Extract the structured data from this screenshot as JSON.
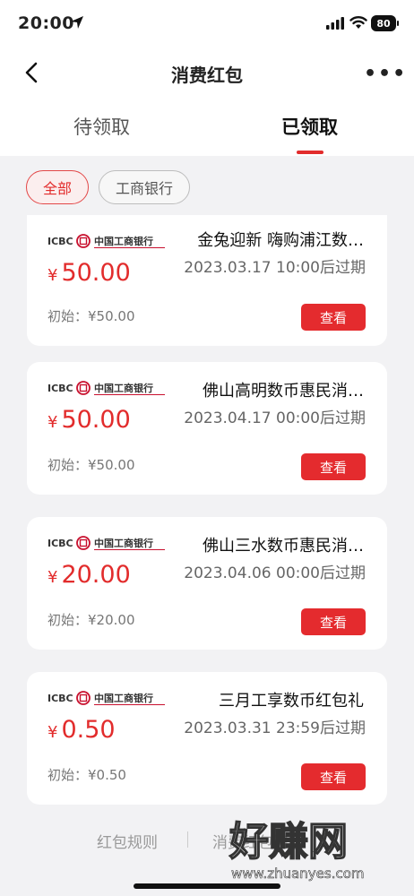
{
  "status": {
    "time": "20:00",
    "battery": "80"
  },
  "nav": {
    "title": "消费红包"
  },
  "tabs": [
    {
      "label": "待领取",
      "active": false
    },
    {
      "label": "已领取",
      "active": true
    }
  ],
  "filters": [
    {
      "label": "全部",
      "selected": true
    },
    {
      "label": "工商银行",
      "selected": false
    }
  ],
  "cards": [
    {
      "bank": "ICBC 中国工商银行",
      "amount": "50.00",
      "currency": "¥",
      "initial": "初始：¥50.00",
      "title": "金兔迎新 嗨购浦江数…",
      "expiry": "2023.03.17 10:00后过期",
      "button": "查看"
    },
    {
      "bank": "ICBC 中国工商银行",
      "amount": "50.00",
      "currency": "¥",
      "initial": "初始：¥50.00",
      "title": "佛山高明数币惠民消…",
      "expiry": "2023.04.17 00:00后过期",
      "button": "查看"
    },
    {
      "bank": "ICBC 中国工商银行",
      "amount": "20.00",
      "currency": "¥",
      "initial": "初始：¥20.00",
      "title": "佛山三水数币惠民消…",
      "expiry": "2023.04.06 00:00后过期",
      "button": "查看"
    },
    {
      "bank": "ICBC 中国工商银行",
      "amount": "0.50",
      "currency": "¥",
      "initial": "初始：¥0.50",
      "title": "三月工享数币红包礼",
      "expiry": "2023.03.31 23:59后过期",
      "button": "查看"
    }
  ],
  "footer": {
    "rules": "红包规则",
    "records": "消费红包记录"
  },
  "watermark": {
    "text": "好赚网",
    "url": "www.zhuanyes.com"
  },
  "colors": {
    "accent": "#e22c2c",
    "icbc_red": "#c8102e"
  }
}
